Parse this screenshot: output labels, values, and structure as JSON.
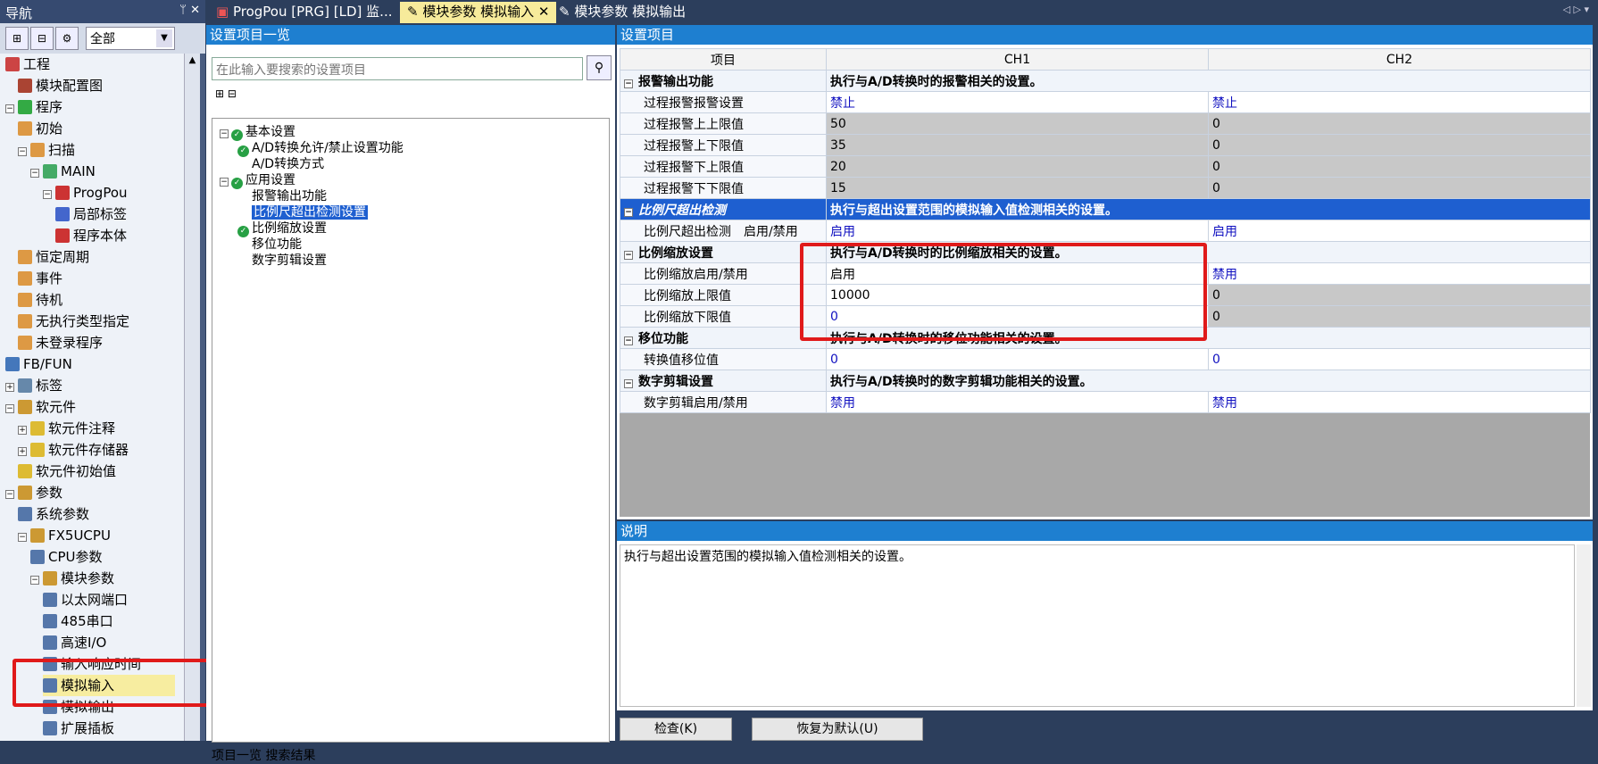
{
  "nav": {
    "title": "导航",
    "controls": "ᛘ ✕",
    "filter": "全部",
    "tree": [
      {
        "label": "工程",
        "indent": 0,
        "icon": "#c44",
        "exp": ""
      },
      {
        "label": "模块配置图",
        "indent": 1,
        "icon": "#a43",
        "exp": ""
      },
      {
        "label": "程序",
        "indent": 0,
        "icon": "#3a4",
        "exp": "⊟"
      },
      {
        "label": "初始",
        "indent": 1,
        "icon": "#d94",
        "exp": ""
      },
      {
        "label": "扫描",
        "indent": 1,
        "icon": "#d94",
        "exp": "⊟"
      },
      {
        "label": "MAIN",
        "indent": 2,
        "icon": "#4a6",
        "exp": "⊟"
      },
      {
        "label": "ProgPou",
        "indent": 3,
        "icon": "#c33",
        "exp": "⊟"
      },
      {
        "label": "局部标签",
        "indent": 4,
        "icon": "#46c",
        "exp": ""
      },
      {
        "label": "程序本体",
        "indent": 4,
        "icon": "#c33",
        "exp": ""
      },
      {
        "label": "恒定周期",
        "indent": 1,
        "icon": "#d94",
        "exp": ""
      },
      {
        "label": "事件",
        "indent": 1,
        "icon": "#d94",
        "exp": ""
      },
      {
        "label": "待机",
        "indent": 1,
        "icon": "#d94",
        "exp": ""
      },
      {
        "label": "无执行类型指定",
        "indent": 1,
        "icon": "#d94",
        "exp": ""
      },
      {
        "label": "未登录程序",
        "indent": 1,
        "icon": "#d94",
        "exp": ""
      },
      {
        "label": "FB/FUN",
        "indent": 0,
        "icon": "#47b",
        "exp": ""
      },
      {
        "label": "标签",
        "indent": 0,
        "icon": "#68a",
        "exp": "⊞"
      },
      {
        "label": "软元件",
        "indent": 0,
        "icon": "#c93",
        "exp": "⊟"
      },
      {
        "label": "软元件注释",
        "indent": 1,
        "icon": "#db3",
        "exp": "⊞"
      },
      {
        "label": "软元件存储器",
        "indent": 1,
        "icon": "#db3",
        "exp": "⊞"
      },
      {
        "label": "软元件初始值",
        "indent": 1,
        "icon": "#db3",
        "exp": ""
      },
      {
        "label": "参数",
        "indent": 0,
        "icon": "#c93",
        "exp": "⊟"
      },
      {
        "label": "系统参数",
        "indent": 1,
        "icon": "#57a",
        "exp": ""
      },
      {
        "label": "FX5UCPU",
        "indent": 1,
        "icon": "#c93",
        "exp": "⊟"
      },
      {
        "label": "CPU参数",
        "indent": 2,
        "icon": "#57a",
        "exp": ""
      },
      {
        "label": "模块参数",
        "indent": 2,
        "icon": "#c93",
        "exp": "⊟"
      },
      {
        "label": "以太网端口",
        "indent": 3,
        "icon": "#57a",
        "exp": ""
      },
      {
        "label": "485串口",
        "indent": 3,
        "icon": "#57a",
        "exp": ""
      },
      {
        "label": "高速I/O",
        "indent": 3,
        "icon": "#57a",
        "exp": ""
      },
      {
        "label": "输入响应时间",
        "indent": 3,
        "icon": "#57a",
        "exp": ""
      },
      {
        "label": "模拟输入",
        "indent": 3,
        "icon": "#57a",
        "exp": "",
        "selected": true
      },
      {
        "label": "模拟输出",
        "indent": 3,
        "icon": "#57a",
        "exp": ""
      },
      {
        "label": "扩展插板",
        "indent": 3,
        "icon": "#57a",
        "exp": ""
      }
    ]
  },
  "tabs": [
    {
      "label": "ProgPou [PRG] [LD] 监...",
      "active": false
    },
    {
      "label": "模块参数 模拟输入 ✕",
      "active": true
    },
    {
      "label": "模块参数 模拟输出",
      "active": false
    }
  ],
  "tab_arrows": "◁ ▷ ▾",
  "setlist": {
    "title": "设置项目一览",
    "search_placeholder": "在此输入要搜索的设置项目",
    "tree": [
      {
        "label": "基本设置",
        "level": 0,
        "check": true,
        "exp": "⊟"
      },
      {
        "label": "A/D转换允许/禁止设置功能",
        "level": 1,
        "check": true
      },
      {
        "label": "A/D转换方式",
        "level": 1,
        "check": false
      },
      {
        "label": "应用设置",
        "level": 0,
        "check": true,
        "exp": "⊟"
      },
      {
        "label": "报警输出功能",
        "level": 1,
        "check": false
      },
      {
        "label": "比例尺超出检测设置",
        "level": 1,
        "check": false,
        "selected": true
      },
      {
        "label": "比例缩放设置",
        "level": 1,
        "check": true
      },
      {
        "label": "移位功能",
        "level": 1,
        "check": false
      },
      {
        "label": "数字剪辑设置",
        "level": 1,
        "check": false
      }
    ],
    "bottom_tabs": "项目一览  搜索结果"
  },
  "items": {
    "title": "设置项目",
    "headers": [
      "项目",
      "CH1",
      "CH2"
    ],
    "rows": [
      {
        "type": "cat",
        "name": "报警输出功能",
        "desc": "执行与A/D转换时的报警相关的设置。"
      },
      {
        "type": "row",
        "name": "过程报警报警设置",
        "ch1": "禁止",
        "ch2": "禁止",
        "c1": "white blue",
        "c2": "white blue"
      },
      {
        "type": "row",
        "name": "过程报警上上限值",
        "ch1": "50",
        "ch2": "0",
        "c1": "gray",
        "c2": "gray"
      },
      {
        "type": "row",
        "name": "过程报警上下限值",
        "ch1": "35",
        "ch2": "0",
        "c1": "gray",
        "c2": "gray"
      },
      {
        "type": "row",
        "name": "过程报警下上限值",
        "ch1": "20",
        "ch2": "0",
        "c1": "gray",
        "c2": "gray"
      },
      {
        "type": "row",
        "name": "过程报警下下限值",
        "ch1": "15",
        "ch2": "0",
        "c1": "gray",
        "c2": "gray"
      },
      {
        "type": "cathl",
        "name": "比例尺超出检测",
        "desc": "执行与超出设置范围的模拟输入值检测相关的设置。"
      },
      {
        "type": "row",
        "name": "比例尺超出检测　启用/禁用",
        "ch1": "启用",
        "ch2": "启用",
        "c1": "white blue",
        "c2": "white blue"
      },
      {
        "type": "cat",
        "name": "比例缩放设置",
        "desc": "执行与A/D转换时的比例缩放相关的设置。"
      },
      {
        "type": "row",
        "name": "比例缩放启用/禁用",
        "ch1": "启用",
        "ch2": "禁用",
        "c1": "white",
        "c2": "white blue"
      },
      {
        "type": "row",
        "name": "比例缩放上限值",
        "ch1": "10000",
        "ch2": "0",
        "c1": "white",
        "c2": "gray"
      },
      {
        "type": "row",
        "name": "比例缩放下限值",
        "ch1": "0",
        "ch2": "0",
        "c1": "white blue",
        "c2": "gray"
      },
      {
        "type": "cat",
        "name": "移位功能",
        "desc": "执行与A/D转换时的移位功能相关的设置。"
      },
      {
        "type": "row",
        "name": "转换值移位值",
        "ch1": "0",
        "ch2": "0",
        "c1": "white blue",
        "c2": "white blue"
      },
      {
        "type": "cat",
        "name": "数字剪辑设置",
        "desc": "执行与A/D转换时的数字剪辑功能相关的设置。"
      },
      {
        "type": "row",
        "name": "数字剪辑启用/禁用",
        "ch1": "禁用",
        "ch2": "禁用",
        "c1": "white blue",
        "c2": "white blue"
      }
    ]
  },
  "desc": {
    "title": "说明",
    "text": "执行与超出设置范围的模拟输入值检测相关的设置。"
  },
  "buttons": {
    "check": "检查(K)",
    "default": "恢复为默认(U)"
  },
  "colors": {
    "highlight_box": "#e01a1a",
    "accent": "#1e7fd0"
  }
}
